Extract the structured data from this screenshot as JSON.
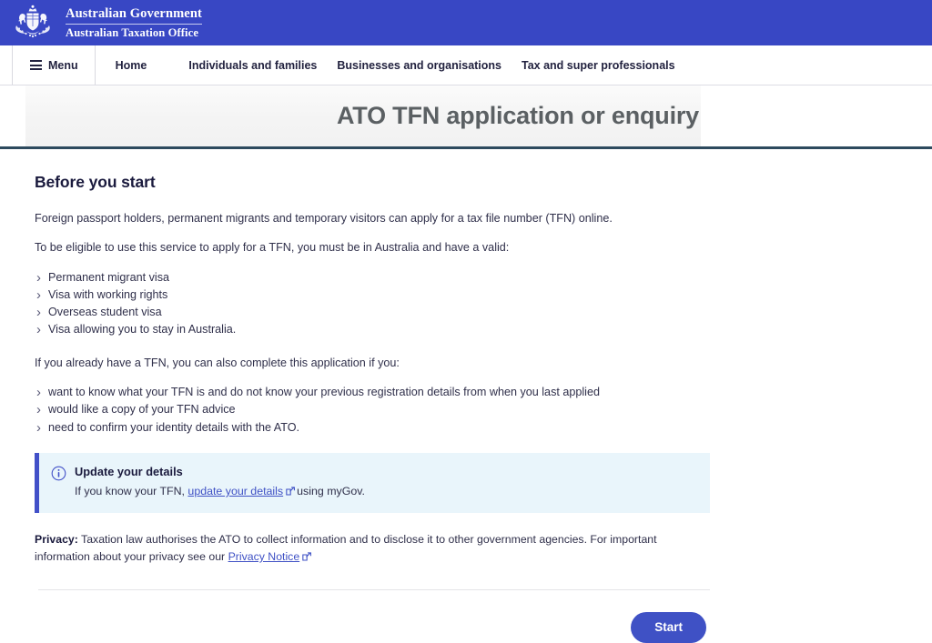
{
  "header": {
    "logo_icon": "australian-coat-of-arms",
    "org_line1": "Australian Government",
    "org_line2": "Australian Taxation Office",
    "background_color": "#3847c4"
  },
  "nav": {
    "menu_icon": "hamburger-icon",
    "menu_label": "Menu",
    "links": [
      {
        "label": "Home"
      },
      {
        "label": "Individuals and families"
      },
      {
        "label": "Businesses and organisations"
      },
      {
        "label": "Tax and super professionals"
      }
    ]
  },
  "banner": {
    "title": "ATO TFN application or enquiry",
    "accent_rule_color": "#2d4a5e"
  },
  "main": {
    "heading": "Before you start",
    "intro_paragraph": "Foreign passport holders, permanent migrants and temporary visitors can apply for a tax file number (TFN) online.",
    "eligibility_lead": "To be eligible to use this service to apply for a TFN, you must be in Australia and have a valid:",
    "eligibility_items": [
      "Permanent migrant visa",
      "Visa with working rights",
      "Overseas student visa",
      "Visa allowing you to stay in Australia."
    ],
    "existing_tfn_lead": "If you already have a TFN, you can also complete this application if you:",
    "existing_tfn_items": [
      "want to know what your TFN is and do not know your previous registration details from when you last applied",
      "would like a copy of your TFN advice",
      "need to confirm your identity details with the ATO."
    ]
  },
  "callout": {
    "icon": "info-circle-icon",
    "title": "Update your details",
    "text_before_link": "If you know your TFN, ",
    "link_label": "update your details",
    "link_icon": "external-link-icon",
    "text_after_link": "using myGov.",
    "accent_color": "#4250c8",
    "background_color": "#e9f5fb"
  },
  "privacy": {
    "label": "Privacy:",
    "text": " Taxation law authorises the ATO to collect information and to disclose it to other government agencies. For important information about your privacy see our ",
    "link_label": "Privacy Notice",
    "link_icon": "external-link-icon"
  },
  "footer": {
    "start_label": "Start",
    "start_color": "#3f51c5"
  }
}
